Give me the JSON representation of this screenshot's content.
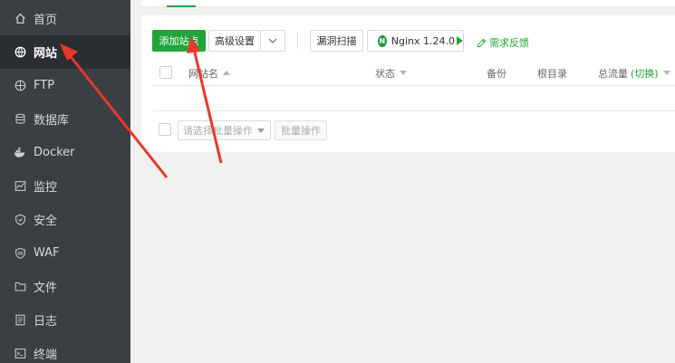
{
  "sidebar": {
    "items": [
      {
        "label": "首页",
        "icon": "home-icon"
      },
      {
        "label": "网站",
        "icon": "globe-icon",
        "active": true
      },
      {
        "label": "FTP",
        "icon": "ftp-globe-icon"
      },
      {
        "label": "数据库",
        "icon": "database-icon"
      },
      {
        "label": "Docker",
        "icon": "docker-icon"
      },
      {
        "label": "监控",
        "icon": "monitor-icon"
      },
      {
        "label": "安全",
        "icon": "shield-icon"
      },
      {
        "label": "WAF",
        "icon": "waf-icon"
      },
      {
        "label": "文件",
        "icon": "folder-icon"
      },
      {
        "label": "日志",
        "icon": "log-icon"
      },
      {
        "label": "终端",
        "icon": "terminal-icon"
      }
    ]
  },
  "toolbar": {
    "add_site": "添加站点",
    "advanced": "高级设置",
    "scan": "漏洞扫描",
    "nginx": "Nginx 1.24.0",
    "feedback": "需求反馈"
  },
  "table": {
    "columns": {
      "site_name": "网站名",
      "status": "状态",
      "backup": "备份",
      "root": "根目录",
      "traffic": "总流量",
      "switch": "(切换)"
    }
  },
  "batch": {
    "select_placeholder": "请选择批量操作",
    "button": "批量操作"
  },
  "colors": {
    "accent": "#20a53a",
    "sidebar_bg": "#3a3f44",
    "annotation_arrow": "#e8382b"
  }
}
